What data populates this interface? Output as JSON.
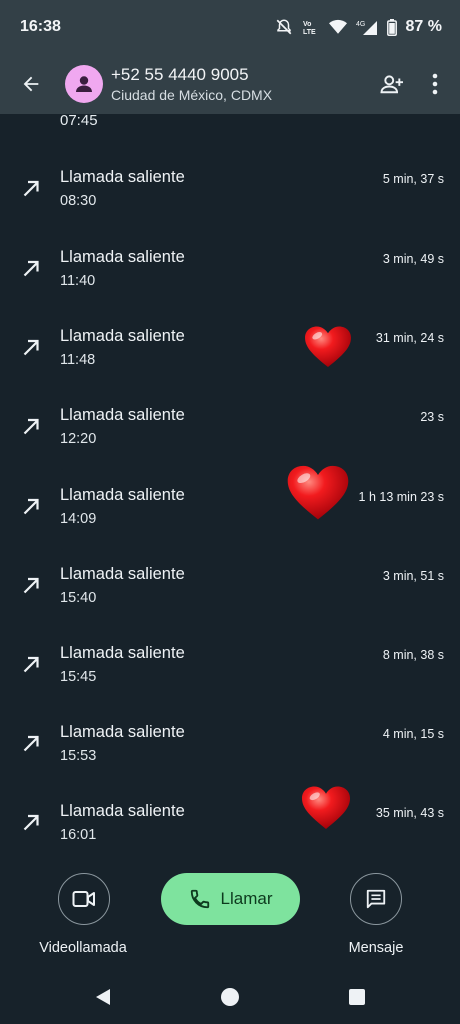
{
  "status": {
    "time": "16:38",
    "battery": "87 %",
    "net": "4G",
    "volte": "VoLTE"
  },
  "header": {
    "phone": "+52 55 4440 9005",
    "location": "Ciudad de México, CDMX"
  },
  "calls": {
    "partial_time": "07:45",
    "items": [
      {
        "title": "Llamada saliente",
        "time": "08:30",
        "duration": "5 min, 37 s"
      },
      {
        "title": "Llamada saliente",
        "time": "11:40",
        "duration": "3 min, 49 s"
      },
      {
        "title": "Llamada saliente",
        "time": "11:48",
        "duration": "31 min, 24 s"
      },
      {
        "title": "Llamada saliente",
        "time": "12:20",
        "duration": "23 s"
      },
      {
        "title": "Llamada saliente",
        "time": "14:09",
        "duration": "1 h 13 min 23 s"
      },
      {
        "title": "Llamada saliente",
        "time": "15:40",
        "duration": "3 min, 51 s"
      },
      {
        "title": "Llamada saliente",
        "time": "15:45",
        "duration": "8 min, 38 s"
      },
      {
        "title": "Llamada saliente",
        "time": "15:53",
        "duration": "4 min, 15 s"
      },
      {
        "title": "Llamada saliente",
        "time": "16:01",
        "duration": "35 min, 43 s"
      }
    ]
  },
  "actions": {
    "video": "Videollamada",
    "call": "Llamar",
    "message": "Mensaje"
  },
  "colors": {
    "background": "#17222a",
    "appbar": "#334047",
    "call_button": "#7ee39e",
    "avatar": "#f0a8f0",
    "heart": "#e0141a"
  },
  "icons": [
    "back-arrow-icon",
    "person-icon",
    "add-contact-icon",
    "more-vert-icon",
    "outgoing-call-icon",
    "heart-sticker",
    "video-icon",
    "phone-icon",
    "message-icon",
    "nav-back-icon",
    "nav-home-icon",
    "nav-recents-icon"
  ]
}
